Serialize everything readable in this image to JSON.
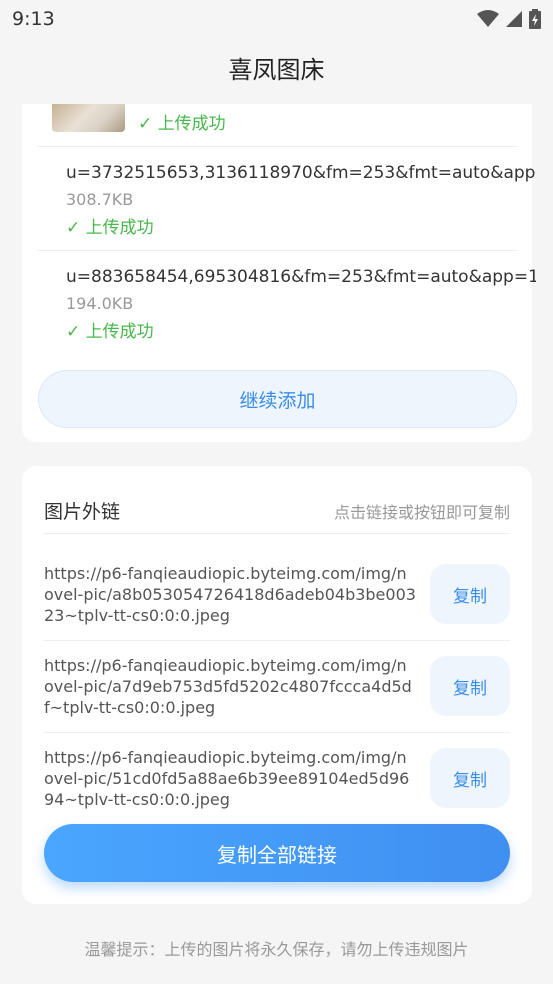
{
  "status_bar": {
    "time": "9:13",
    "icons": [
      "wifi-icon",
      "signal-icon",
      "battery-charging-icon"
    ]
  },
  "app": {
    "title": "喜凤图床"
  },
  "uploads": [
    {
      "name": "",
      "size": "",
      "status": "✓ 上传成功",
      "has_thumb": true
    },
    {
      "name": "u=3732515653,3136118970&fm=253&fmt=auto&app",
      "size": "308.7KB",
      "status": "✓ 上传成功"
    },
    {
      "name": "u=883658454,695304816&fm=253&fmt=auto&app=1",
      "size": "194.0KB",
      "status": "✓ 上传成功"
    }
  ],
  "add_button": {
    "label": "继续添加"
  },
  "links_section": {
    "title": "图片外链",
    "hint": "点击链接或按钮即可复制",
    "links": [
      {
        "url": "https://p6-fanqieaudiopic.byteimg.com/img/novel-pic/a8b053054726418d6adeb04b3be00323~tplv-tt-cs0:0:0.jpeg",
        "copy_label": "复制"
      },
      {
        "url": "https://p6-fanqieaudiopic.byteimg.com/img/novel-pic/a7d9eb753d5fd5202c4807fccca4d5df~tplv-tt-cs0:0:0.jpeg",
        "copy_label": "复制"
      },
      {
        "url": "https://p6-fanqieaudiopic.byteimg.com/img/novel-pic/51cd0fd5a88ae6b39ee89104ed5d9694~tplv-tt-cs0:0:0.jpeg",
        "copy_label": "复制"
      }
    ],
    "copy_all_label": "复制全部链接"
  },
  "footer": {
    "tip": "温馨提示：上传的图片将永久保存，请勿上传违规图片"
  },
  "colors": {
    "accent": "#3a8ee6",
    "success": "#47b84b",
    "background": "#f5f5f5"
  }
}
